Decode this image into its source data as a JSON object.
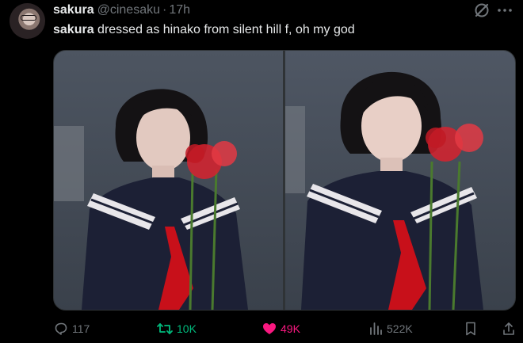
{
  "tweet": {
    "display_name": "sakura",
    "handle": "@cinesaku",
    "separator": "·",
    "time": "17h",
    "quoted_name": "sakura",
    "body": "dressed as hinako from silent hill f, oh my god"
  },
  "media": {
    "photo_count": 2
  },
  "actions": {
    "replies": "117",
    "retweets": "10K",
    "likes": "49K",
    "views": "522K"
  },
  "colors": {
    "background": "#000000",
    "text": "#e7e9ea",
    "muted": "#71767b",
    "retweet_active": "#00ba7c",
    "like_active": "#f91880"
  },
  "icons": {
    "grok": "grok-icon",
    "more": "more-icon",
    "reply": "reply-icon",
    "retweet": "retweet-icon",
    "like": "heart-icon",
    "views": "views-icon",
    "bookmark": "bookmark-icon",
    "share": "share-icon"
  }
}
